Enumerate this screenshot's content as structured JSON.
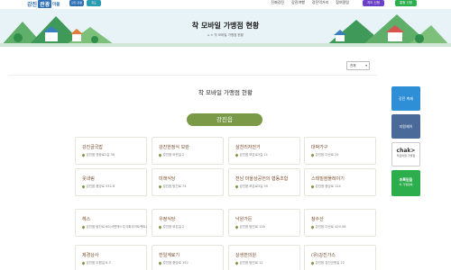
{
  "header": {
    "logo_part1": "강진",
    "logo_part2": "관광",
    "logo_part3": "마을",
    "badge1": "강진 관광",
    "badge2": "지도",
    "nav": [
      "진짜강진",
      "강진여행",
      "강진먹거리",
      "참여알림"
    ],
    "btn_purple": "지도 신청",
    "btn_green": "통합 신청"
  },
  "banner": {
    "title": "착 모바일 가맹점 현황",
    "breadcrumb": "⌂  >  착 모바일 가맹점 현황"
  },
  "filter": {
    "selected": "전체"
  },
  "section_title": "착 모바일 가맹점 현황",
  "region_pill": "강진읍",
  "cards": [
    {
      "name": "강진골국밥",
      "addr": "강진읍 영랑로1길 38"
    },
    {
      "name": "강진한정식 모란",
      "addr": "강진읍 모란길 2"
    },
    {
      "name": "삼천리자전거",
      "addr": "강진읍 보은로3길 11"
    },
    {
      "name": "대박가구",
      "addr": "강진읍 다산로 25"
    },
    {
      "name": "옷내림",
      "addr": "강진읍 중앙로 532-8"
    },
    {
      "name": "미래식당",
      "addr": "강진읍 탐진로 74"
    },
    {
      "name": "전남 마을상공헌의 협동조합",
      "addr": "강진읍 보은로3길 50"
    },
    {
      "name": "스테빌컴플레이기",
      "addr": "강진읍 중앙로 124"
    },
    {
      "name": "헤스",
      "addr": "강진읍 탐진로 60(서편매스주식회사어트렉트)"
    },
    {
      "name": "우정식당",
      "addr": "강진읍 보은길 2"
    },
    {
      "name": "낙원가든",
      "addr": "강진읍 탐진로 128"
    },
    {
      "name": "참수산",
      "addr": "강진읍 다산로 429-58"
    },
    {
      "name": "제경상사",
      "addr": "강진읍 도원길 8-3"
    },
    {
      "name": "한일계료기",
      "addr": "강진읍 중앙로 152"
    },
    {
      "name": "상생한의원",
      "addr": "강진읍 탐진로 12"
    },
    {
      "name": "(유)강진가스",
      "addr": "강진읍 강진군청길 22"
    }
  ],
  "quickmenu": {
    "q1": "강진 축제",
    "q2": "지원제어",
    "q3_big": "chak>",
    "q3_small": "착모바일 가맹점",
    "q4_a": "초록믿음",
    "q4_b": "이 가맹점에"
  },
  "colors": {
    "brand_blue": "#2f6fb5",
    "pill_green": "#7a9a47",
    "card_title": "#7a4a2a",
    "banner_bg": "#e7f3f7"
  }
}
